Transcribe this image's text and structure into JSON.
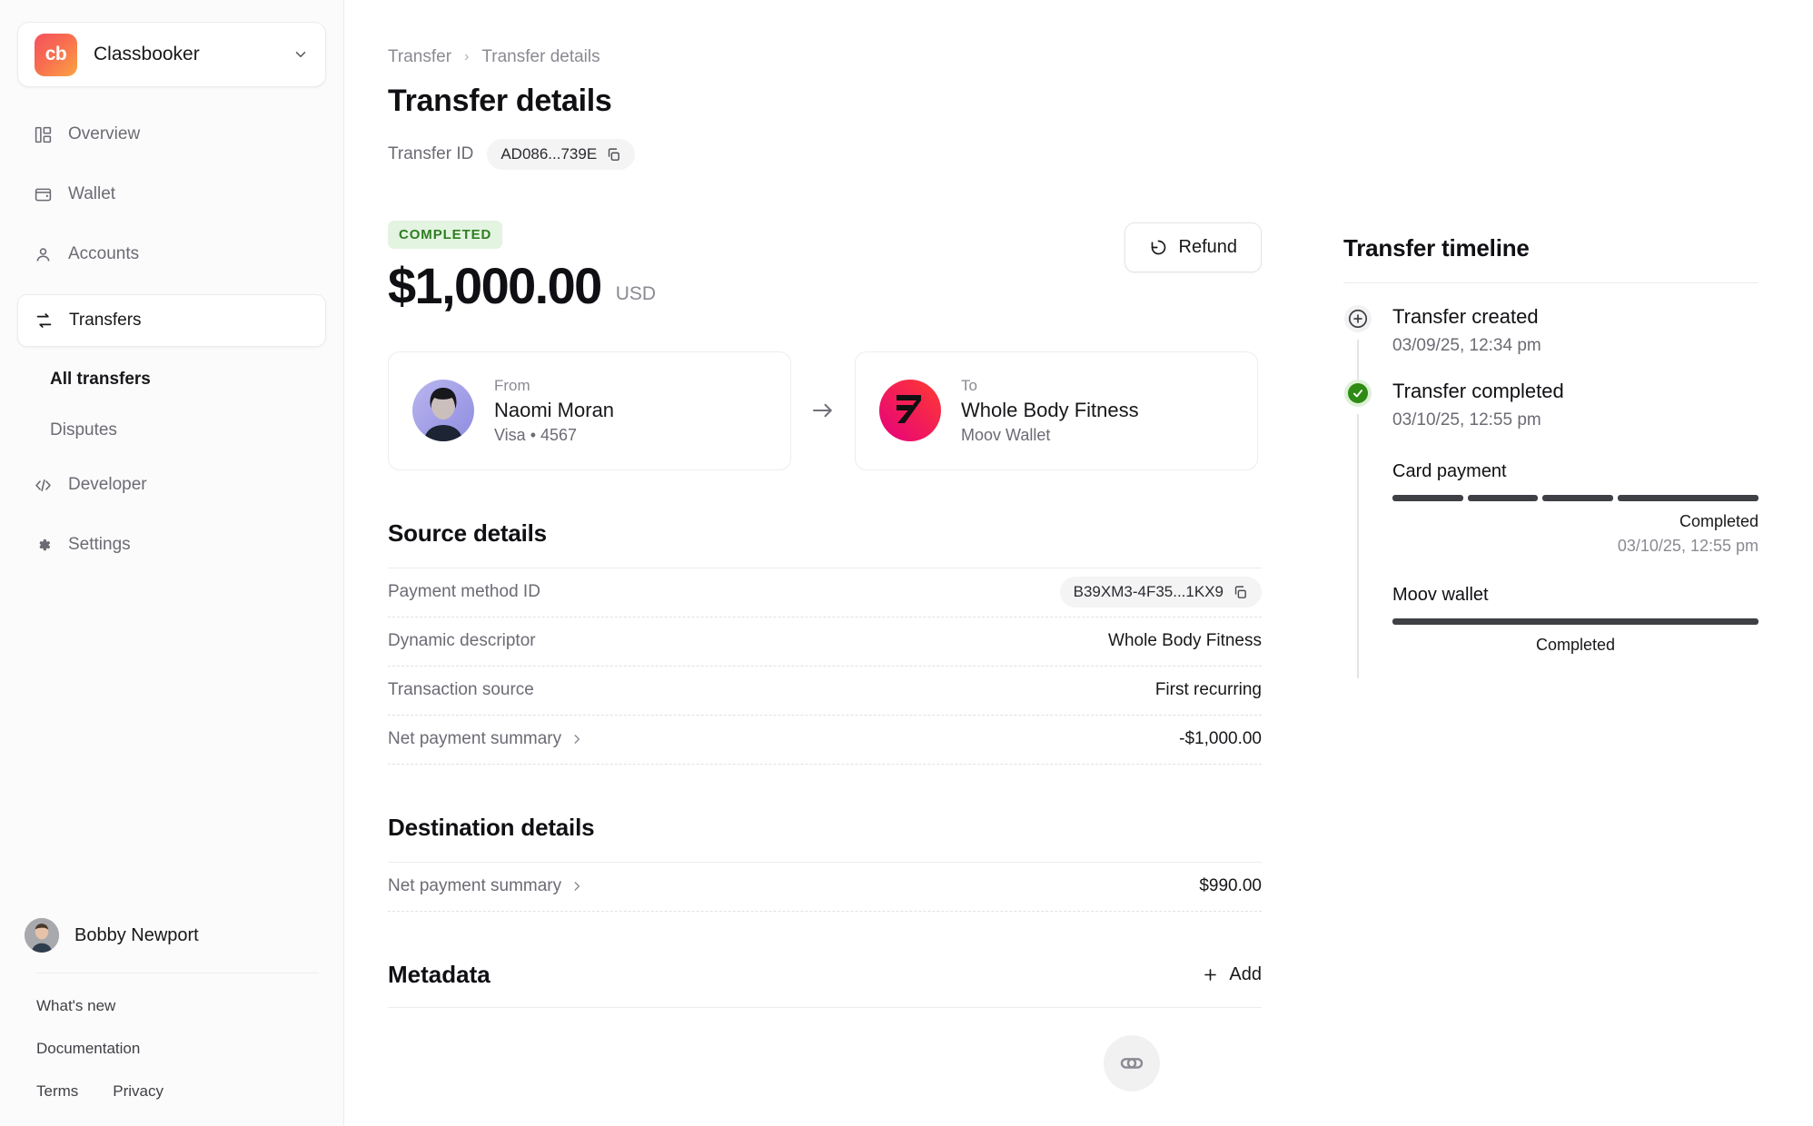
{
  "sidebar": {
    "org": {
      "name": "Classbooker",
      "logo_text": "cb",
      "logo_colors": [
        "#f5515f",
        "#fba343"
      ]
    },
    "nav": [
      {
        "label": "Overview",
        "icon": "dashboard-icon",
        "active": false
      },
      {
        "label": "Wallet",
        "icon": "wallet-icon",
        "active": false
      },
      {
        "label": "Accounts",
        "icon": "person-icon",
        "active": false
      },
      {
        "label": "Transfers",
        "icon": "transfers-icon",
        "active": true
      }
    ],
    "sub_items": [
      {
        "label": "All transfers",
        "current": true
      },
      {
        "label": "Disputes",
        "current": false
      }
    ],
    "nav_bottom": [
      {
        "label": "Developer",
        "icon": "code-icon"
      },
      {
        "label": "Settings",
        "icon": "gear-icon"
      }
    ],
    "user": {
      "name": "Bobby Newport"
    },
    "footer_links": [
      "What's new",
      "Documentation"
    ],
    "footer_inline": [
      "Terms",
      "Privacy"
    ]
  },
  "header": {
    "breadcrumb": [
      "Transfer",
      "Transfer details"
    ],
    "separator": "›",
    "title": "Transfer details",
    "transfer_id_label": "Transfer ID",
    "transfer_id_value": "AD086...739E"
  },
  "summary": {
    "status": "COMPLETED",
    "status_color": "#2f7d22",
    "status_bg": "#e3f4e0",
    "amount": "$1,000.00",
    "currency": "USD",
    "refund_label": "Refund"
  },
  "parties": {
    "from": {
      "kicker": "From",
      "name": "Naomi Moran",
      "sub": "Visa • 4567"
    },
    "to": {
      "kicker": "To",
      "name": "Whole Body Fitness",
      "sub": "Moov Wallet"
    },
    "arrow": "→"
  },
  "source_details": {
    "title": "Source details",
    "rows": [
      {
        "key": "Payment method ID",
        "value": "B39XM3-4F35...1KX9",
        "type": "pill"
      },
      {
        "key": "Dynamic descriptor",
        "value": "Whole Body Fitness",
        "type": "text"
      },
      {
        "key": "Transaction source",
        "value": "First recurring",
        "type": "text"
      },
      {
        "key": "Net payment summary",
        "value": "-$1,000.00",
        "type": "expand"
      }
    ]
  },
  "destination_details": {
    "title": "Destination details",
    "rows": [
      {
        "key": "Net payment summary",
        "value": "$990.00",
        "type": "expand"
      }
    ]
  },
  "metadata": {
    "title": "Metadata",
    "add_label": "Add",
    "add_icon": "plus-icon"
  },
  "fab": {
    "icon": "paperclip-icon"
  },
  "timeline": {
    "title": "Transfer timeline",
    "events": [
      {
        "label": "Transfer created",
        "time": "03/09/25, 12:34 pm",
        "state": "created"
      },
      {
        "label": "Transfer completed",
        "time": "03/10/25, 12:55 pm",
        "state": "completed"
      }
    ],
    "rails": [
      {
        "name": "Card payment",
        "segments": 4,
        "filled": 4,
        "status": "Completed",
        "time": "03/10/25, 12:55 pm",
        "align": "right"
      },
      {
        "name": "Moov wallet",
        "segments": 1,
        "filled": 1,
        "status": "Completed",
        "time": "",
        "align": "center"
      }
    ]
  }
}
